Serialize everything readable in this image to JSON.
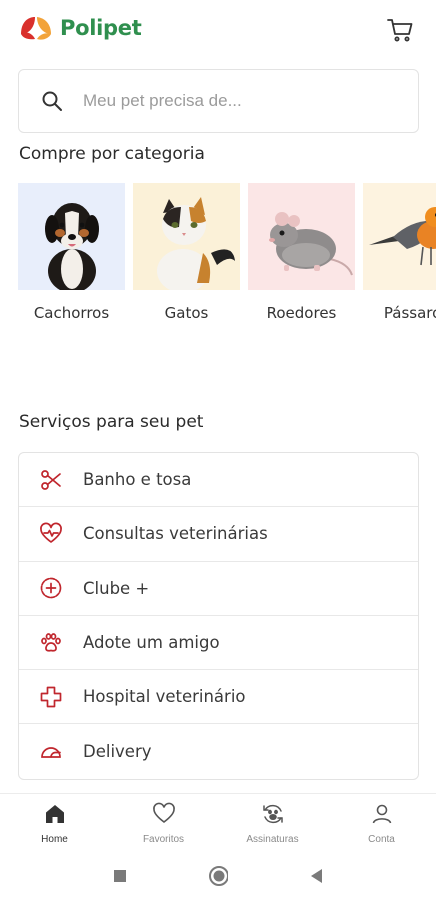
{
  "header": {
    "brand": "Polipet",
    "cart_icon": "cart-icon"
  },
  "search": {
    "placeholder": "Meu pet precisa de...",
    "value": ""
  },
  "categories": {
    "title": "Compre por categoria",
    "items": [
      {
        "label": "Cachorros",
        "bg": "#e8eefb"
      },
      {
        "label": "Gatos",
        "bg": "#fbf1d8"
      },
      {
        "label": "Roedores",
        "bg": "#fbe6e6"
      },
      {
        "label": "Pássaros",
        "bg": "#fdf3e0"
      }
    ]
  },
  "services": {
    "title": "Serviços para seu pet",
    "items": [
      {
        "label": "Banho e tosa",
        "icon": "scissors-icon"
      },
      {
        "label": "Consultas veterinárias",
        "icon": "heart-pulse-icon"
      },
      {
        "label": "Clube +",
        "icon": "club-plus-icon"
      },
      {
        "label": "Adote um amigo",
        "icon": "paw-icon"
      },
      {
        "label": "Hospital veterinário",
        "icon": "hospital-cross-icon"
      },
      {
        "label": "Delivery",
        "icon": "delivery-icon"
      }
    ]
  },
  "bottom_nav": {
    "items": [
      {
        "label": "Home",
        "icon": "home-icon",
        "active": true
      },
      {
        "label": "Favoritos",
        "icon": "heart-icon",
        "active": false
      },
      {
        "label": "Assinaturas",
        "icon": "subscription-icon",
        "active": false
      },
      {
        "label": "Conta",
        "icon": "user-icon",
        "active": false
      }
    ]
  },
  "colors": {
    "brand_green": "#2f8f4e",
    "accent_red": "#c0262d",
    "logo_orange": "#f2a33a"
  }
}
